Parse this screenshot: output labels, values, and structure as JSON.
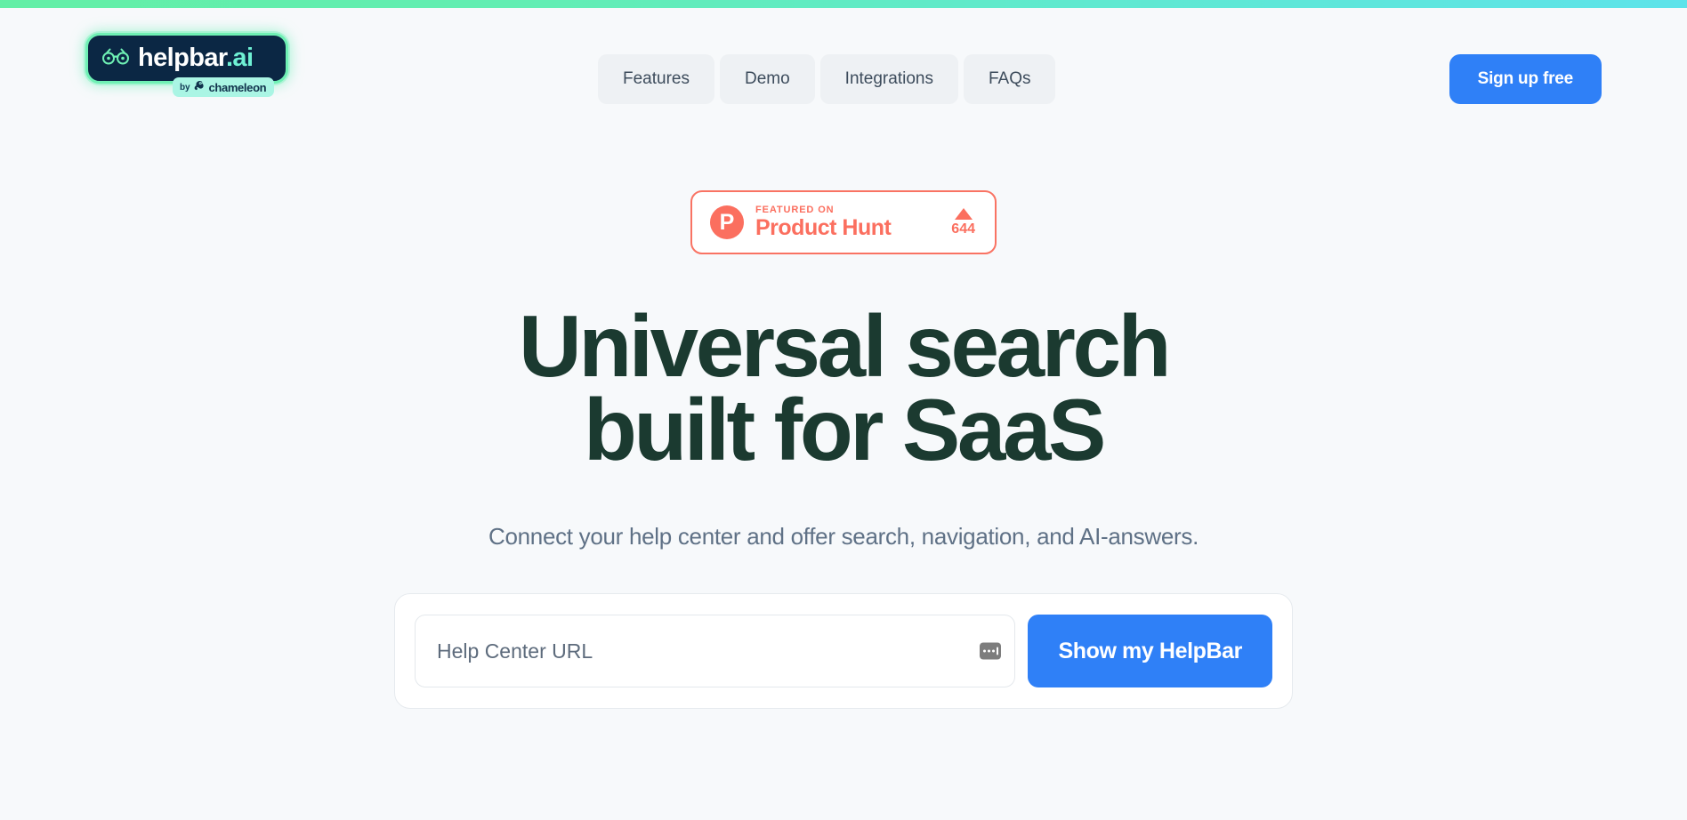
{
  "theme": {
    "page_bg": "#f7f9fb",
    "accent_blue": "#2f80f7",
    "brand_green": "#63efa6",
    "brand_cyan": "#5de3ea",
    "heading_color": "#1b3a30",
    "producthunt_coral": "#fb6f5f",
    "logo_navy": "#0b2744"
  },
  "topbar": {
    "gradient_from": "#63efa6",
    "gradient_to": "#5de3ea"
  },
  "header": {
    "logo": {
      "icon": "binoculars-icon",
      "name": "helpbar",
      "suffix": ".ai",
      "byline_prefix": "by",
      "byline_brand": "chameleon",
      "byline_icon": "chameleon-icon"
    },
    "nav": [
      {
        "label": "Features"
      },
      {
        "label": "Demo"
      },
      {
        "label": "Integrations"
      },
      {
        "label": "FAQs"
      }
    ],
    "signup": {
      "label": "Sign up free"
    }
  },
  "hero": {
    "product_hunt": {
      "logo_letter": "P",
      "featured_label": "FEATURED ON",
      "name": "Product Hunt",
      "upvote_icon": "upvote-triangle-icon",
      "votes": "644"
    },
    "headline_line1": "Universal search",
    "headline_line2": "built for SaaS",
    "subtitle": "Connect your help center and offer search, navigation, and AI-answers.",
    "form": {
      "input_value": "",
      "input_placeholder": "Help Center URL",
      "autofill_icon": "autofill-dots-icon",
      "submit_label": "Show my HelpBar"
    }
  }
}
